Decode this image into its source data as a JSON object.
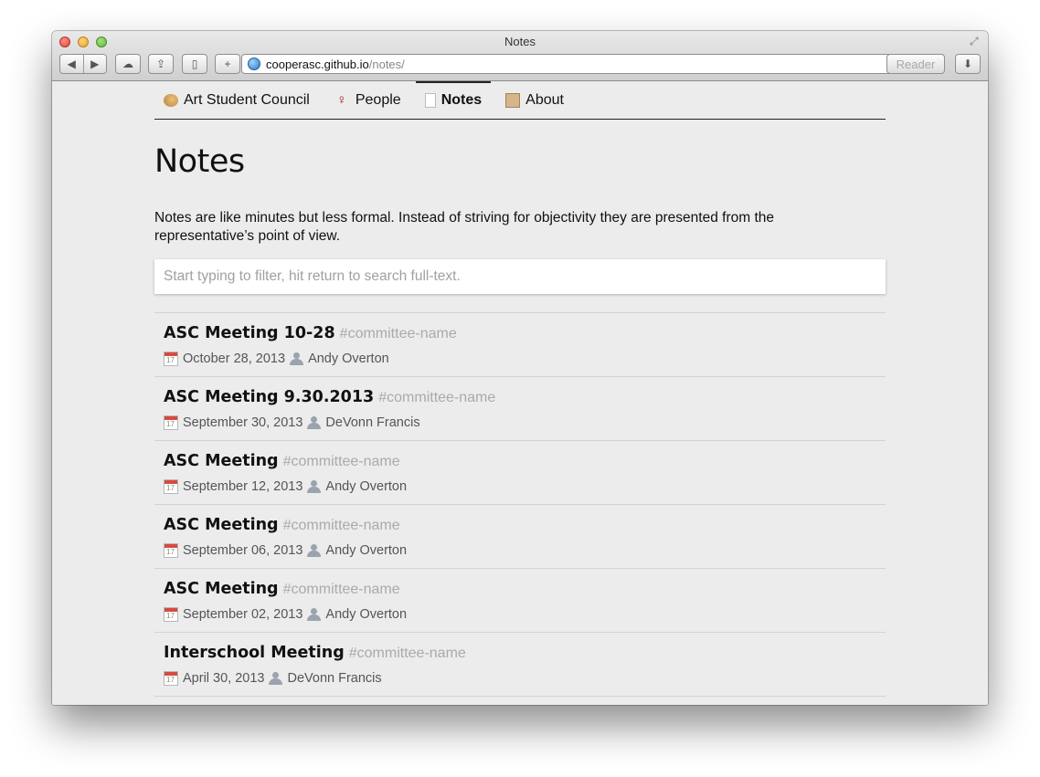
{
  "window": {
    "title": "Notes"
  },
  "toolbar": {
    "url_host": "cooperasc.github.io",
    "url_path": "/notes/",
    "reader_label": "Reader"
  },
  "nav": {
    "items": [
      {
        "label": "Art Student Council",
        "icon": "palette-icon"
      },
      {
        "label": "People",
        "icon": "dancer-icon"
      },
      {
        "label": "Notes",
        "icon": "page-icon",
        "active": true
      },
      {
        "label": "About",
        "icon": "scroll-icon"
      }
    ]
  },
  "page": {
    "title": "Notes",
    "intro": "Notes are like minutes but less formal. Instead of striving for objectivity they are presented from the representative’s point of view.",
    "filter_placeholder": "Start typing to filter, hit return to search full-text."
  },
  "notes": [
    {
      "title": "ASC Meeting 10-28",
      "tag": "#committee-name",
      "date": "October 28, 2013",
      "author": "Andy Overton"
    },
    {
      "title": "ASC Meeting 9.30.2013",
      "tag": "#committee-name",
      "date": "September 30, 2013",
      "author": "DeVonn Francis"
    },
    {
      "title": "ASC Meeting",
      "tag": "#committee-name",
      "date": "September 12, 2013",
      "author": "Andy Overton"
    },
    {
      "title": "ASC Meeting",
      "tag": "#committee-name",
      "date": "September 06, 2013",
      "author": "Andy Overton"
    },
    {
      "title": "ASC Meeting",
      "tag": "#committee-name",
      "date": "September 02, 2013",
      "author": "Andy Overton"
    },
    {
      "title": "Interschool Meeting",
      "tag": "#committee-name",
      "date": "April 30, 2013",
      "author": "DeVonn Francis"
    }
  ],
  "colors": {
    "tag": "#aaaaaa",
    "calendar_accent": "#d64a43"
  }
}
